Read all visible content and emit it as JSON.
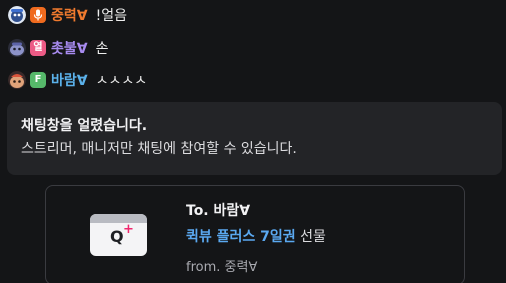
{
  "messages": [
    {
      "avatar_icon": "user-avatar-icon",
      "badge_icon": "microphone-icon",
      "badge_color": "#f06b1f",
      "nickname": "중력∀",
      "nickname_color": "#f07a2e",
      "text": "!얼음"
    },
    {
      "avatar_icon": "user-avatar-icon",
      "badge_text": "열",
      "badge_color": "#ec5b86",
      "nickname": "촛불∀",
      "nickname_color": "#a88bf0",
      "text": "손"
    },
    {
      "avatar_icon": "user-avatar-icon",
      "badge_text": "F",
      "badge_color": "#56b86a",
      "nickname": "바람∀",
      "nickname_color": "#5bb1ea",
      "text": "ㅅㅅㅅㅅ"
    }
  ],
  "notice": {
    "title": "채팅창을 얼렸습니다.",
    "body": "스트리머, 매니저만 채팅에 참여할 수 있습니다."
  },
  "gift": {
    "icon": "qview-plus-ticket-icon",
    "to": "To. 바람∀",
    "item_name": "퀵뷰 플러스 7일권",
    "item_suffix": " 선물",
    "item_color": "#5aa8f0",
    "from": "from. 중력∀"
  }
}
